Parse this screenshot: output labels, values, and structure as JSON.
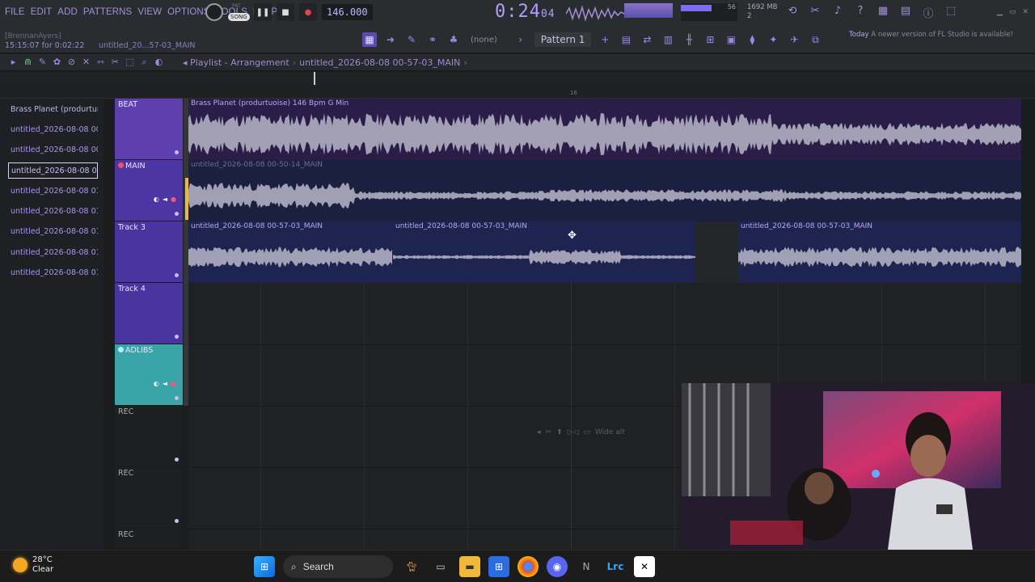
{
  "menu": [
    "FILE",
    "EDIT",
    "ADD",
    "PATTERNS",
    "VIEW",
    "OPTIONS",
    "TOOLS",
    "HELP"
  ],
  "user": "[BrennanAyers]",
  "timeline_hint": "15:15:07 for 0:02:22",
  "project_short": "untitled_20...57-03_MAIN",
  "transport": {
    "pat_label": "PAT",
    "song_label": "SONG",
    "tempo": "146.000"
  },
  "clock": {
    "main": "0:24",
    "sub": "04"
  },
  "cpu": {
    "value": "56"
  },
  "memory": {
    "value": "1692 MB",
    "sub": "2"
  },
  "pattern_selector": {
    "none_label": "(none)",
    "pattern": "Pattern 1"
  },
  "update_note": {
    "today": "Today",
    "text": "A newer version of FL Studio is available!"
  },
  "playlist": {
    "title": "Playlist - Arrangement",
    "project": "untitled_2026-08-08 00-57-03_MAIN"
  },
  "ruler": {
    "bar": "16"
  },
  "picker": [
    "Brass Planet (produrtur...",
    "untitled_2026-08-08 00-...",
    "untitled_2026-08-08 00-...",
    "untitled_2026-08-08 00-...",
    "untitled_2026-08-08 01-...",
    "untitled_2026-08-08 01-...",
    "untitled_2026-08-08 01-...",
    "untitled_2026-08-08 01-...",
    "untitled_2026-08-08 01-..."
  ],
  "tracks": [
    "BEAT",
    "MAIN",
    "Track 3",
    "Track 4",
    "ADLIBS",
    "REC",
    "REC",
    "REC"
  ],
  "clips": {
    "beat": "Brass Planet (produrtuoise) 146 Bpm G Min",
    "main": "untitled_2026-08-08 00-50-14_MAIN",
    "t3a": "untitled_2026-08-08 00-57-03_MAIN",
    "t3b": "untitled_2026-08-08 00-57-03_MAIN",
    "t3c": "untitled_2026-08-08 00-57-03_MAIN"
  },
  "hint": "Wide alt",
  "taskbar": {
    "temp": "28°C",
    "cond": "Clear",
    "search": "Search",
    "apps": [
      "windows-start",
      "search",
      "cat-app",
      "task-view",
      "file-explorer",
      "store",
      "chrome",
      "discord",
      "notion",
      "lightroom-classic",
      "capcut"
    ]
  },
  "colors": {
    "accent": "#a48fd8",
    "track_header": "#5b3fae",
    "adlibs_header": "#3a9a9a",
    "waveform": "#b9b6c8"
  }
}
